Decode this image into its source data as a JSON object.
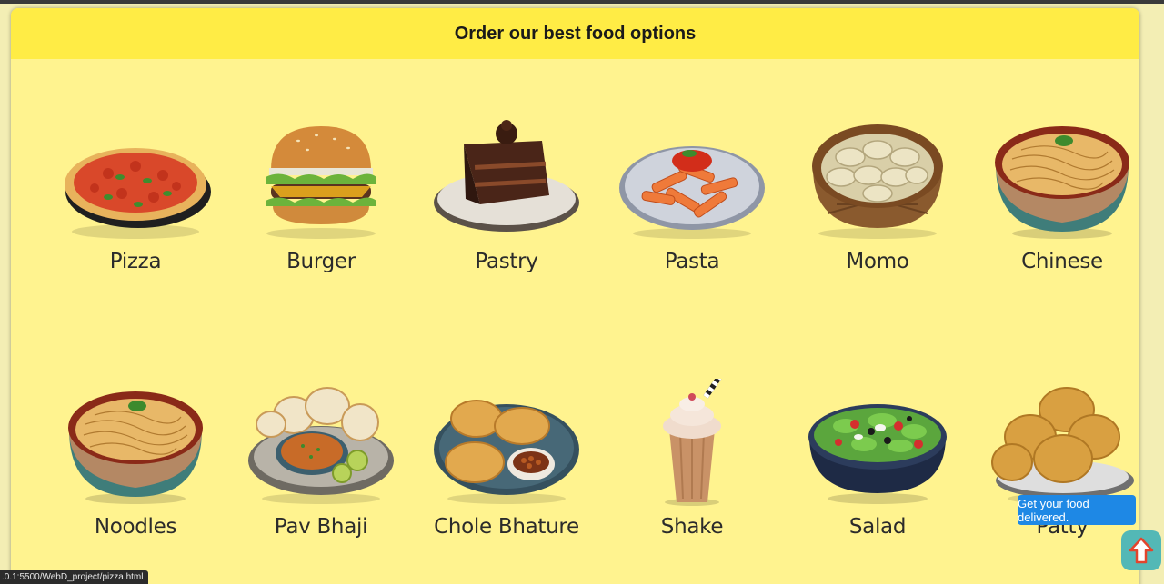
{
  "header": {
    "title": "Order our best food options"
  },
  "foods": [
    {
      "label": "Pizza",
      "icon": "pizza-icon"
    },
    {
      "label": "Burger",
      "icon": "burger-icon"
    },
    {
      "label": "Pastry",
      "icon": "pastry-icon"
    },
    {
      "label": "Pasta",
      "icon": "pasta-icon"
    },
    {
      "label": "Momo",
      "icon": "momo-icon"
    },
    {
      "label": "Chinese",
      "icon": "chinese-icon"
    },
    {
      "label": "Noodles",
      "icon": "noodles-icon"
    },
    {
      "label": "Pav Bhaji",
      "icon": "pav-bhaji-icon"
    },
    {
      "label": "Chole Bhature",
      "icon": "chole-bhature-icon"
    },
    {
      "label": "Shake",
      "icon": "shake-icon"
    },
    {
      "label": "Salad",
      "icon": "salad-icon"
    },
    {
      "label": "Patty",
      "icon": "patty-icon"
    }
  ],
  "tooltip": {
    "text": "Get your food delivered."
  },
  "status_bar": {
    "url": ".0.1:5500/WebD_project/pizza.html"
  },
  "colors": {
    "panel": "#fff38f",
    "header": "#ffec45",
    "tooltip": "#1e88e5",
    "scroll_button": "#53b8b6"
  }
}
